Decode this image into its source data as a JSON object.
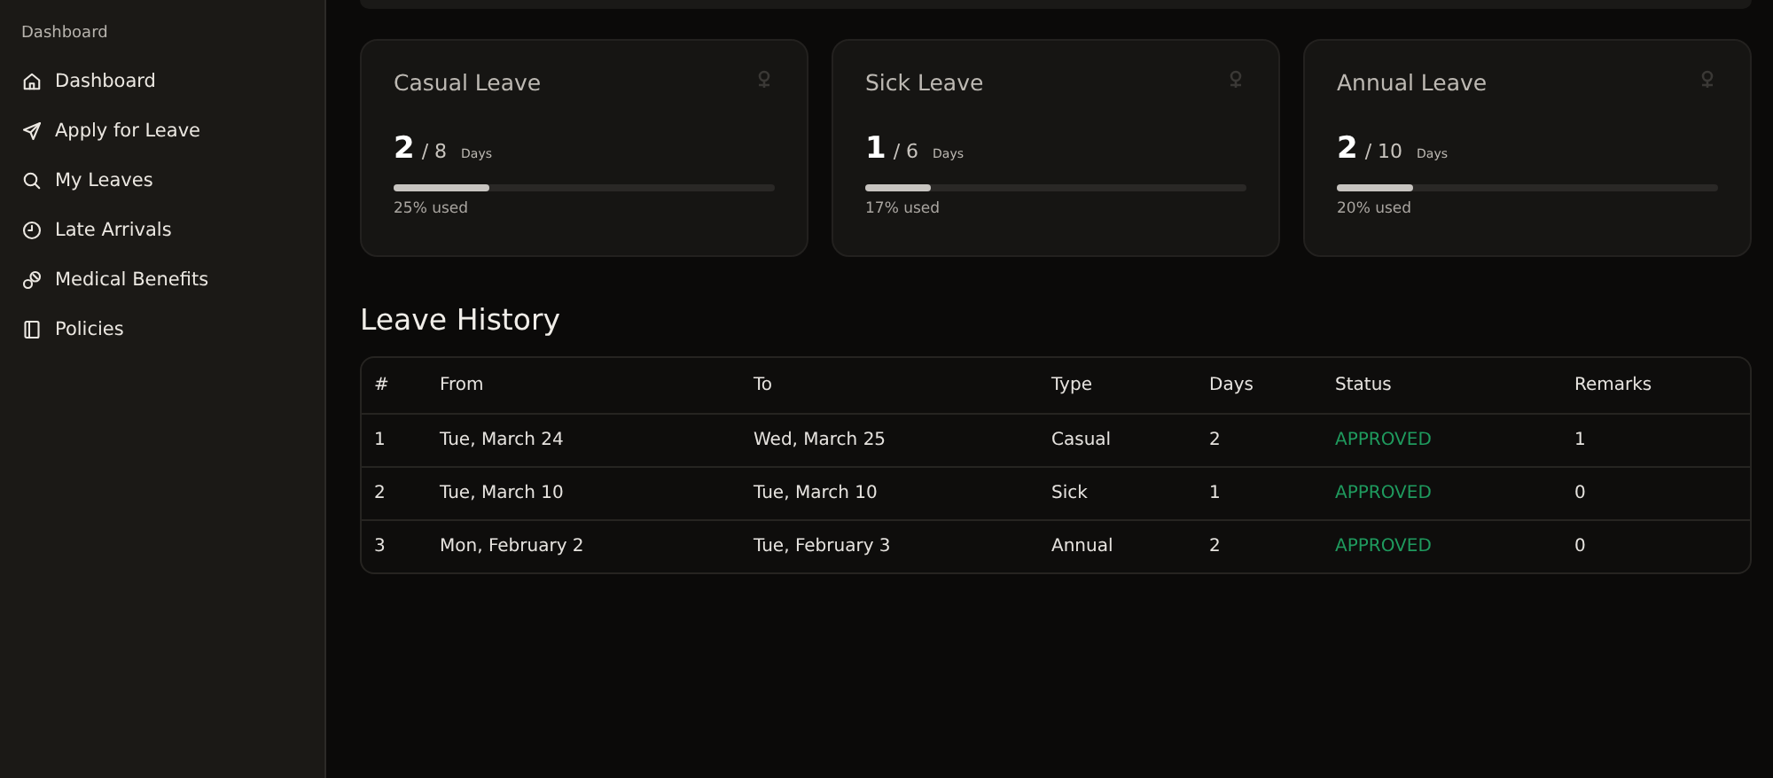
{
  "sidebar": {
    "section": "Dashboard",
    "items": [
      {
        "label": "Dashboard"
      },
      {
        "label": "Apply for Leave"
      },
      {
        "label": "My Leaves"
      },
      {
        "label": "Late Arrivals"
      },
      {
        "label": "Medical Benefits"
      },
      {
        "label": "Policies"
      }
    ]
  },
  "cards": [
    {
      "title": "Casual Leave",
      "used": "2",
      "total": "/ 8",
      "unit": "Days",
      "level": 0.25,
      "caption": "25% used"
    },
    {
      "title": "Sick Leave",
      "used": "1",
      "total": "/ 6",
      "unit": "Days",
      "level": 0.17,
      "caption": "17% used"
    },
    {
      "title": "Annual Leave",
      "used": "2",
      "total": "/ 10",
      "unit": "Days",
      "level": 0.2,
      "caption": "20% used"
    }
  ],
  "history": {
    "title": "Leave History",
    "columns": [
      "#",
      "From",
      "To",
      "Type",
      "Days",
      "Status",
      "Remarks"
    ],
    "rows": [
      [
        "1",
        "Tue, March 24",
        "Wed, March 25",
        "Casual",
        "2",
        "APPROVED",
        "1"
      ],
      [
        "2",
        "Tue, March 10",
        "Tue, March 10",
        "Sick",
        "1",
        "APPROVED",
        "0"
      ],
      [
        "3",
        "Mon, February 2",
        "Tue, February 3",
        "Annual",
        "2",
        "APPROVED",
        "0"
      ]
    ]
  }
}
